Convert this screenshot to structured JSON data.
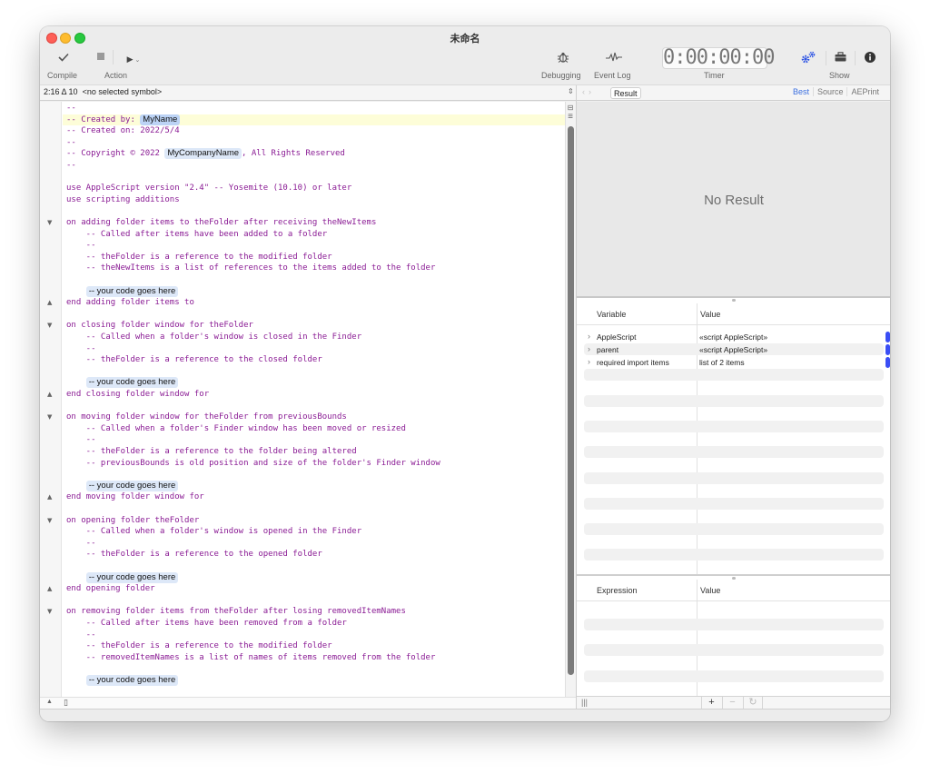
{
  "window": {
    "title": "未命名"
  },
  "toolbar": {
    "compile_label": "Compile",
    "action_label": "Action",
    "debugging_label": "Debugging",
    "event_log_label": "Event Log",
    "timer_value": "0:00:00:00",
    "timer_label": "Timer",
    "show_label": "Show",
    "icons": {
      "compile": "checkmark-icon",
      "stop": "stop-icon",
      "run": "play-icon",
      "debugging": "bug-icon",
      "event_log": "waveform-icon",
      "gears": "gears-icon",
      "library": "briefcase-icon",
      "info": "info-icon"
    },
    "accent_color": "#2f55e4"
  },
  "navbar": {
    "position": "2:16 Δ 10",
    "symbol": "<no selected symbol>",
    "result_button": "Result",
    "view_tabs": [
      "Best",
      "Source",
      "AEPrint"
    ],
    "active_view_tab": "Best"
  },
  "editor": {
    "lines": [
      {
        "text": "--"
      },
      {
        "text": "-- Created by: ",
        "token": "MyName",
        "token_selected": true,
        "current": true
      },
      {
        "text": "-- Created on: 2022/5/4"
      },
      {
        "text": "--"
      },
      {
        "text": "-- Copyright © 2022 ",
        "token": "MyCompanyName",
        "after": ", All Rights Reserved"
      },
      {
        "text": "--"
      },
      {
        "text": ""
      },
      {
        "text": "use AppleScript version \"2.4\" -- Yosemite (10.10) or later"
      },
      {
        "text": "use scripting additions"
      },
      {
        "text": ""
      },
      {
        "text": "on adding folder items to theFolder after receiving theNewItems",
        "fold": "open"
      },
      {
        "text": "    -- Called after items have been added to a folder"
      },
      {
        "text": "    --"
      },
      {
        "text": "    -- theFolder is a reference to the modified folder"
      },
      {
        "text": "    -- theNewItems is a list of references to the items added to the folder"
      },
      {
        "text": ""
      },
      {
        "text": "    ",
        "token": "-- your code goes here"
      },
      {
        "text": "end adding folder items to",
        "fold": "close"
      },
      {
        "text": ""
      },
      {
        "text": "on closing folder window for theFolder",
        "fold": "open"
      },
      {
        "text": "    -- Called when a folder's window is closed in the Finder"
      },
      {
        "text": "    --"
      },
      {
        "text": "    -- theFolder is a reference to the closed folder"
      },
      {
        "text": ""
      },
      {
        "text": "    ",
        "token": "-- your code goes here"
      },
      {
        "text": "end closing folder window for",
        "fold": "close"
      },
      {
        "text": ""
      },
      {
        "text": "on moving folder window for theFolder from previousBounds",
        "fold": "open"
      },
      {
        "text": "    -- Called when a folder's Finder window has been moved or resized"
      },
      {
        "text": "    --"
      },
      {
        "text": "    -- theFolder is a reference to the folder being altered"
      },
      {
        "text": "    -- previousBounds is old position and size of the folder's Finder window"
      },
      {
        "text": ""
      },
      {
        "text": "    ",
        "token": "-- your code goes here"
      },
      {
        "text": "end moving folder window for",
        "fold": "close"
      },
      {
        "text": ""
      },
      {
        "text": "on opening folder theFolder",
        "fold": "open"
      },
      {
        "text": "    -- Called when a folder's window is opened in the Finder"
      },
      {
        "text": "    --"
      },
      {
        "text": "    -- theFolder is a reference to the opened folder"
      },
      {
        "text": ""
      },
      {
        "text": "    ",
        "token": "-- your code goes here"
      },
      {
        "text": "end opening folder",
        "fold": "close"
      },
      {
        "text": ""
      },
      {
        "text": "on removing folder items from theFolder after losing removedItemNames",
        "fold": "open"
      },
      {
        "text": "    -- Called after items have been removed from a folder"
      },
      {
        "text": "    --"
      },
      {
        "text": "    -- theFolder is a reference to the modified folder"
      },
      {
        "text": "    -- removedItemNames is a list of names of items removed from the folder"
      },
      {
        "text": ""
      },
      {
        "text": "    ",
        "token": "-- your code goes here"
      }
    ],
    "code_color": "#8a1b94"
  },
  "result": {
    "empty_text": "No Result"
  },
  "variables": {
    "headers": [
      "Variable",
      "Value"
    ],
    "rows": [
      {
        "name": "AppleScript",
        "value": "«script AppleScript»"
      },
      {
        "name": "parent",
        "value": "«script AppleScript»"
      },
      {
        "name": "required import items",
        "value": "list of 2 items"
      }
    ]
  },
  "expressions": {
    "headers": [
      "Expression",
      "Value"
    ],
    "rows": []
  },
  "watch_footer": {
    "add": "+",
    "remove": "−",
    "refresh": "↻"
  }
}
